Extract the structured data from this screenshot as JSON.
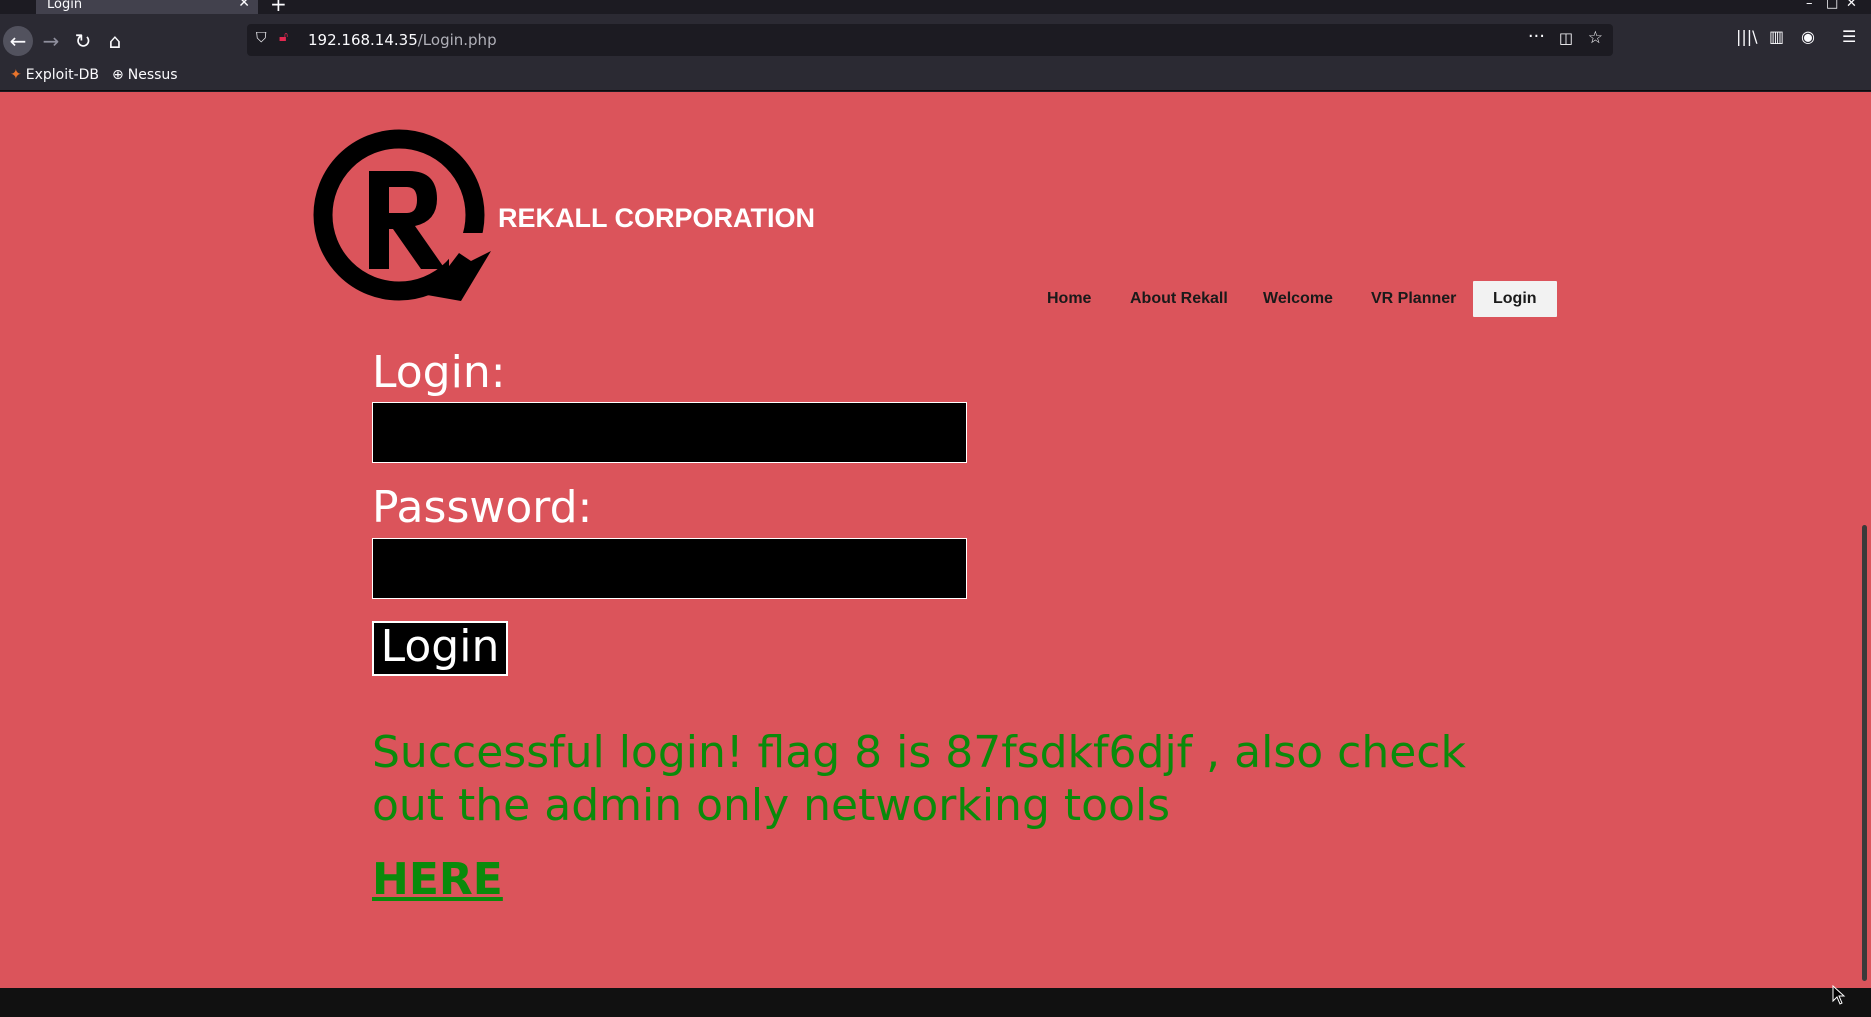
{
  "browser": {
    "tab_title": "Login",
    "tab_close": "✕",
    "new_tab": "+",
    "url_host": "192.168.14.35",
    "url_path": "/Login.php",
    "bookmarks": [
      {
        "label": "Exploit-DB",
        "icon": "exploit-db-icon"
      },
      {
        "label": "Nessus",
        "icon": "globe-icon"
      }
    ]
  },
  "site": {
    "company_name": "REKALL CORPORATION",
    "nav": [
      "Home",
      "About Rekall",
      "Welcome",
      "VR Planner",
      "Login"
    ],
    "active_nav": "Login"
  },
  "form": {
    "login_label": "Login:",
    "password_label": "Password:",
    "login_value": "",
    "password_value": "",
    "submit_label": "Login"
  },
  "message": {
    "success_text": "Successful login! flag 8 is 87fsdkf6djf , also check out the admin only networking tools",
    "link_text": "HERE"
  },
  "colors": {
    "page_background": "#db545b",
    "success_green": "#0b8a0b",
    "chrome_dark": "#2b2a33"
  }
}
